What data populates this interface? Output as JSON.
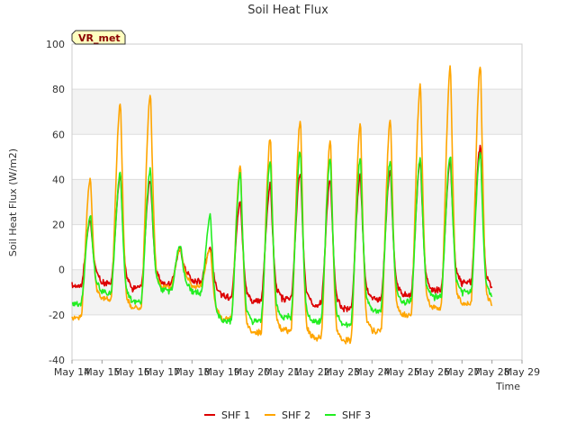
{
  "chart_data": {
    "type": "line",
    "title": "Soil Heat Flux",
    "xlabel": "Time",
    "ylabel": "Soil Heat Flux (W/m2)",
    "site_badge": "VR_met",
    "ylim": [
      -40,
      100
    ],
    "yticks": [
      -40,
      -20,
      0,
      20,
      40,
      60,
      80,
      100
    ],
    "xlim": [
      14,
      29
    ],
    "xticks": [
      14,
      15,
      16,
      17,
      18,
      19,
      20,
      21,
      22,
      23,
      24,
      25,
      26,
      27,
      28,
      29
    ],
    "xtick_labels": [
      "May 14",
      "May 15",
      "May 16",
      "May 17",
      "May 18",
      "May 19",
      "May 20",
      "May 21",
      "May 22",
      "May 23",
      "May 24",
      "May 25",
      "May 26",
      "May 27",
      "May 28",
      "May 29"
    ],
    "grid": true,
    "legend_position": "bottom-center",
    "series": [
      {
        "name": "SHF 1",
        "color": "#dd0000",
        "days": [
          {
            "min": -7,
            "max": 22
          },
          {
            "min": -6,
            "max": 42
          },
          {
            "min": -8,
            "max": 40
          },
          {
            "min": -6,
            "max": 9
          },
          {
            "min": -5,
            "max": 10
          },
          {
            "min": -12,
            "max": 30
          },
          {
            "min": -14,
            "max": 38
          },
          {
            "min": -13,
            "max": 43
          },
          {
            "min": -15,
            "max": 40
          },
          {
            "min": -17,
            "max": 42
          },
          {
            "min": -13,
            "max": 44
          },
          {
            "min": -11,
            "max": 48
          },
          {
            "min": -9,
            "max": 48
          },
          {
            "min": -6,
            "max": 55
          }
        ],
        "final": -8
      },
      {
        "name": "SHF 2",
        "color": "#ffa500",
        "days": [
          {
            "min": -21,
            "max": 41
          },
          {
            "min": -13,
            "max": 74
          },
          {
            "min": -17,
            "max": 78
          },
          {
            "min": -8,
            "max": 10
          },
          {
            "min": -7,
            "max": 9
          },
          {
            "min": -22,
            "max": 46
          },
          {
            "min": -28,
            "max": 59
          },
          {
            "min": -27,
            "max": 67
          },
          {
            "min": -30,
            "max": 57
          },
          {
            "min": -31,
            "max": 65
          },
          {
            "min": -27,
            "max": 67
          },
          {
            "min": -20,
            "max": 82
          },
          {
            "min": -17,
            "max": 90
          },
          {
            "min": -15,
            "max": 91
          }
        ],
        "final": -16
      },
      {
        "name": "SHF 3",
        "color": "#22ee22",
        "days": [
          {
            "min": -15,
            "max": 24
          },
          {
            "min": -10,
            "max": 43
          },
          {
            "min": -14,
            "max": 45
          },
          {
            "min": -9,
            "max": 11
          },
          {
            "min": -10,
            "max": 24
          },
          {
            "min": -23,
            "max": 43
          },
          {
            "min": -23,
            "max": 49
          },
          {
            "min": -21,
            "max": 53
          },
          {
            "min": -23,
            "max": 50
          },
          {
            "min": -24,
            "max": 50
          },
          {
            "min": -18,
            "max": 49
          },
          {
            "min": -14,
            "max": 50
          },
          {
            "min": -12,
            "max": 51
          },
          {
            "min": -10,
            "max": 52
          }
        ],
        "final": -12
      }
    ]
  }
}
